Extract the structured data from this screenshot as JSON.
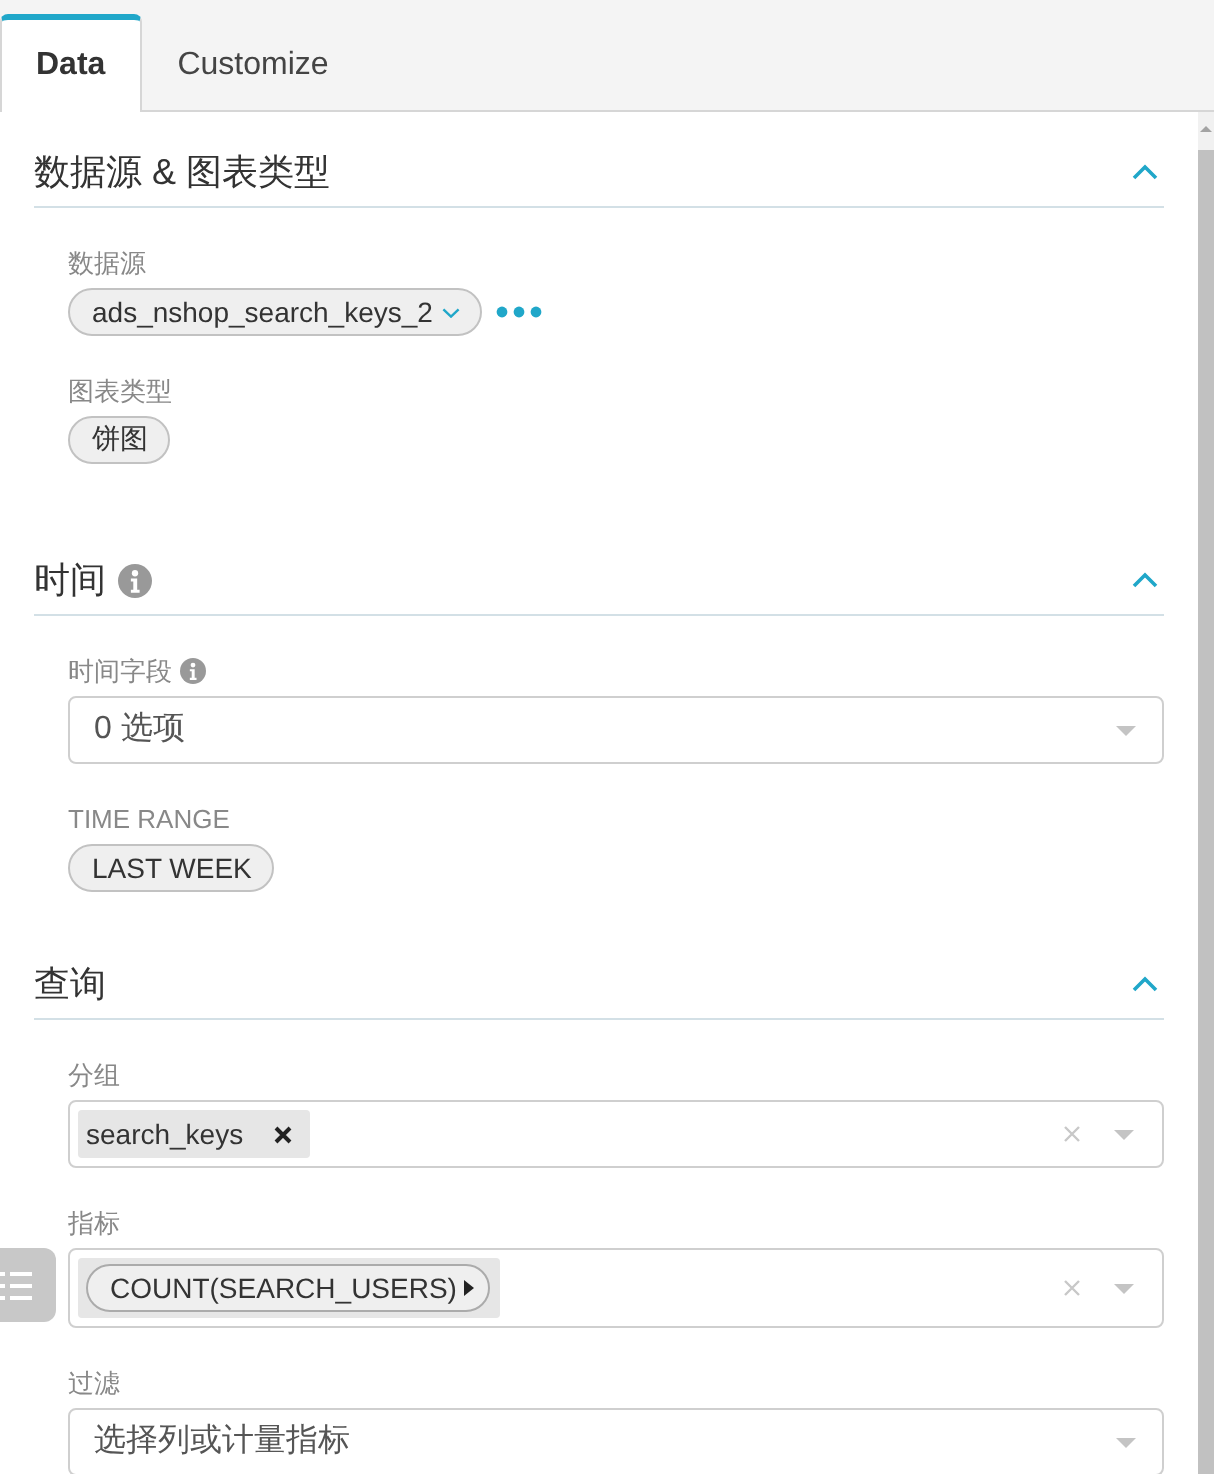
{
  "tabs": [
    {
      "label": "Data",
      "selected": true
    },
    {
      "label": "Customize",
      "selected": false
    }
  ],
  "sections": [
    {
      "title": "数据源 & 图表类型",
      "info": false,
      "expanded": true,
      "fields": [
        {
          "kind": "source",
          "label": "数据源",
          "info": false,
          "value": "ads_nshop_search_keys_2"
        },
        {
          "kind": "pill",
          "label": "图表类型",
          "info": false,
          "value": "饼图"
        }
      ]
    },
    {
      "title": "时间",
      "info": true,
      "expanded": true,
      "fields": [
        {
          "kind": "select",
          "label": "时间字段",
          "info": true,
          "placeholder": "0 选项"
        },
        {
          "kind": "pill",
          "label": "TIME RANGE",
          "info": false,
          "value": "LAST WEEK"
        }
      ]
    },
    {
      "title": "查询",
      "info": false,
      "expanded": true,
      "fields": [
        {
          "kind": "multi",
          "label": "分组",
          "info": false,
          "tags": [
            {
              "kind": "column",
              "label": "search_keys"
            }
          ]
        },
        {
          "kind": "multi",
          "label": "指标",
          "info": false,
          "tags": [
            {
              "kind": "metric",
              "label": "COUNT(SEARCH_USERS)"
            }
          ]
        },
        {
          "kind": "select",
          "label": "过滤",
          "info": false,
          "placeholder": "选择列或计量指标"
        }
      ]
    }
  ]
}
